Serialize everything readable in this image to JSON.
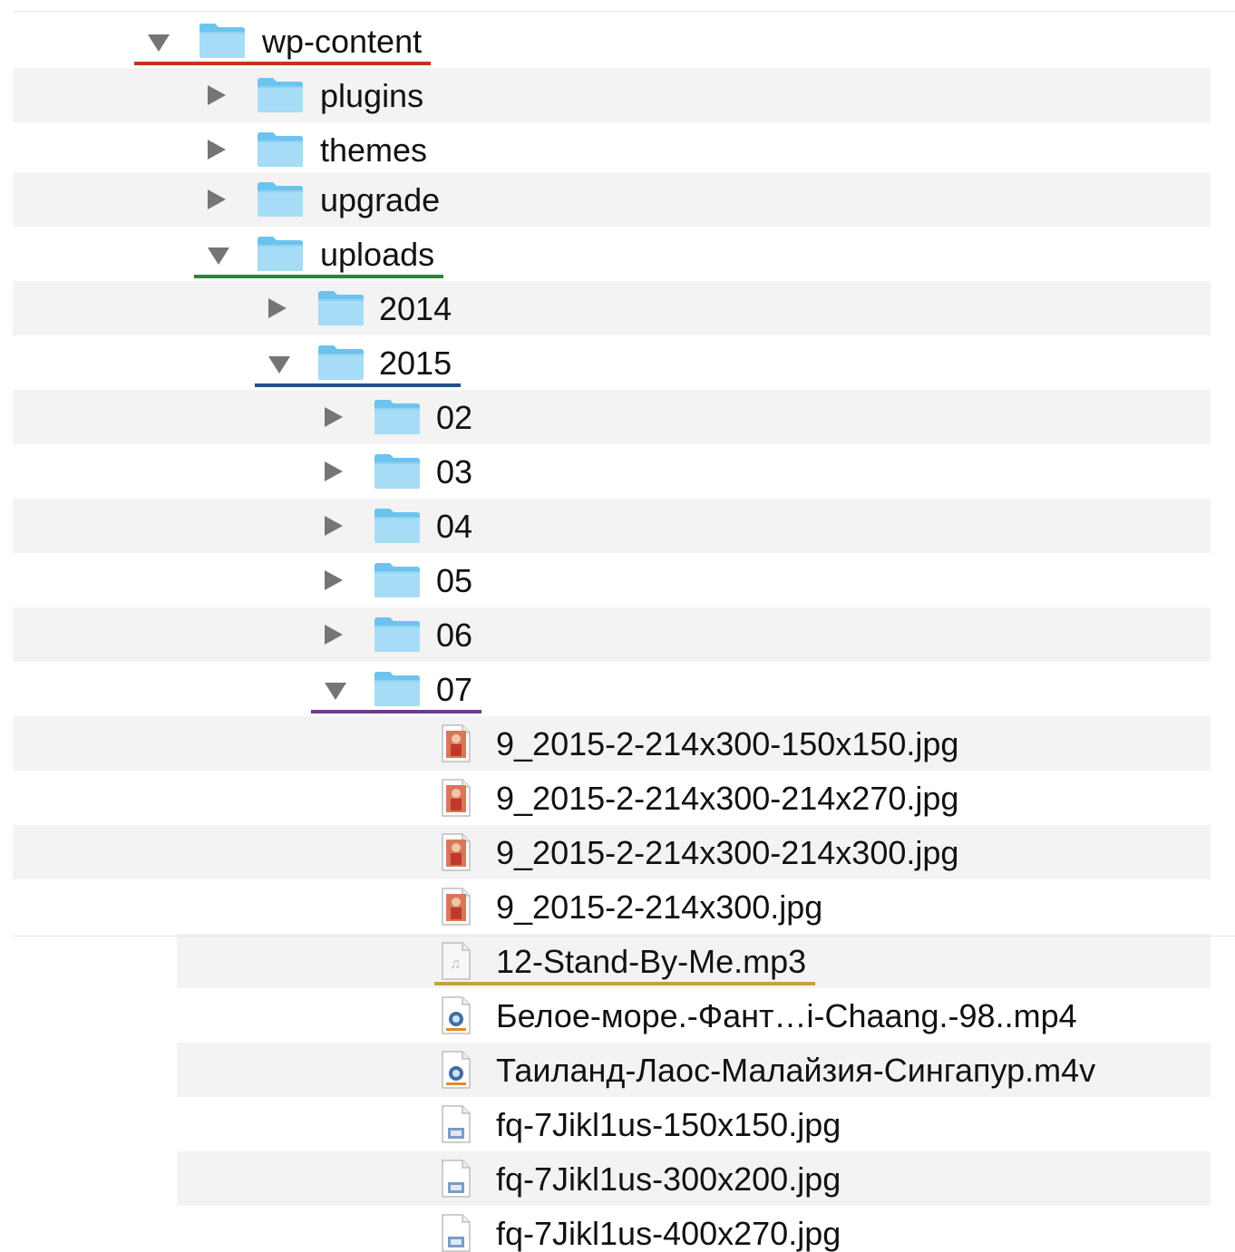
{
  "tree": {
    "items": [
      {
        "name": "wp-content",
        "type": "folder",
        "expanded": true,
        "depth": 0
      },
      {
        "name": "plugins",
        "type": "folder",
        "expanded": false,
        "depth": 1
      },
      {
        "name": "themes",
        "type": "folder",
        "expanded": false,
        "depth": 1
      },
      {
        "name": "upgrade",
        "type": "folder",
        "expanded": false,
        "depth": 1
      },
      {
        "name": "uploads",
        "type": "folder",
        "expanded": true,
        "depth": 1
      },
      {
        "name": "2014",
        "type": "folder",
        "expanded": false,
        "depth": 2
      },
      {
        "name": "2015",
        "type": "folder",
        "expanded": true,
        "depth": 2
      },
      {
        "name": "02",
        "type": "folder",
        "expanded": false,
        "depth": 3
      },
      {
        "name": "03",
        "type": "folder",
        "expanded": false,
        "depth": 3
      },
      {
        "name": "04",
        "type": "folder",
        "expanded": false,
        "depth": 3
      },
      {
        "name": "05",
        "type": "folder",
        "expanded": false,
        "depth": 3
      },
      {
        "name": "06",
        "type": "folder",
        "expanded": false,
        "depth": 3
      },
      {
        "name": "07",
        "type": "folder",
        "expanded": true,
        "depth": 3
      },
      {
        "name": "9_2015-2-214x300-150x150.jpg",
        "type": "image-file",
        "depth": 4
      },
      {
        "name": "9_2015-2-214x300-214x270.jpg",
        "type": "image-file",
        "depth": 4
      },
      {
        "name": "9_2015-2-214x300-214x300.jpg",
        "type": "image-file",
        "depth": 4
      },
      {
        "name": "9_2015-2-214x300.jpg",
        "type": "image-file",
        "depth": 4
      },
      {
        "name": "12-Stand-By-Me.mp3",
        "type": "audio-file",
        "depth": 4
      },
      {
        "name": "Белое-море.-Фант…i-Chaang.-98..mp4",
        "type": "video-file",
        "depth": 4
      },
      {
        "name": "Таиланд-Лаос-Малайзия-Сингапур.m4v",
        "type": "video-file",
        "depth": 4
      },
      {
        "name": "fq-7Jikl1us-150x150.jpg",
        "type": "generic-image-file",
        "depth": 4
      },
      {
        "name": "fq-7Jikl1us-300x200.jpg",
        "type": "generic-image-file",
        "depth": 4
      },
      {
        "name": "fq-7Jikl1us-400x270.jpg",
        "type": "generic-image-file",
        "depth": 4
      }
    ]
  },
  "highlights": [
    {
      "item": "wp-content",
      "color": "#c8321e"
    },
    {
      "item": "uploads",
      "color": "#1e8c3a"
    },
    {
      "item": "2015",
      "color": "#1f4f8f"
    },
    {
      "item": "07",
      "color": "#6a3c8c"
    },
    {
      "item": "12-Stand-By-Me.mp3",
      "color": "#c9a13a"
    }
  ],
  "colors": {
    "folder": "#6cc3ef",
    "folder_light": "#a6dcf6",
    "disclosure": "#757575",
    "stripe": "#f3f3f3"
  }
}
